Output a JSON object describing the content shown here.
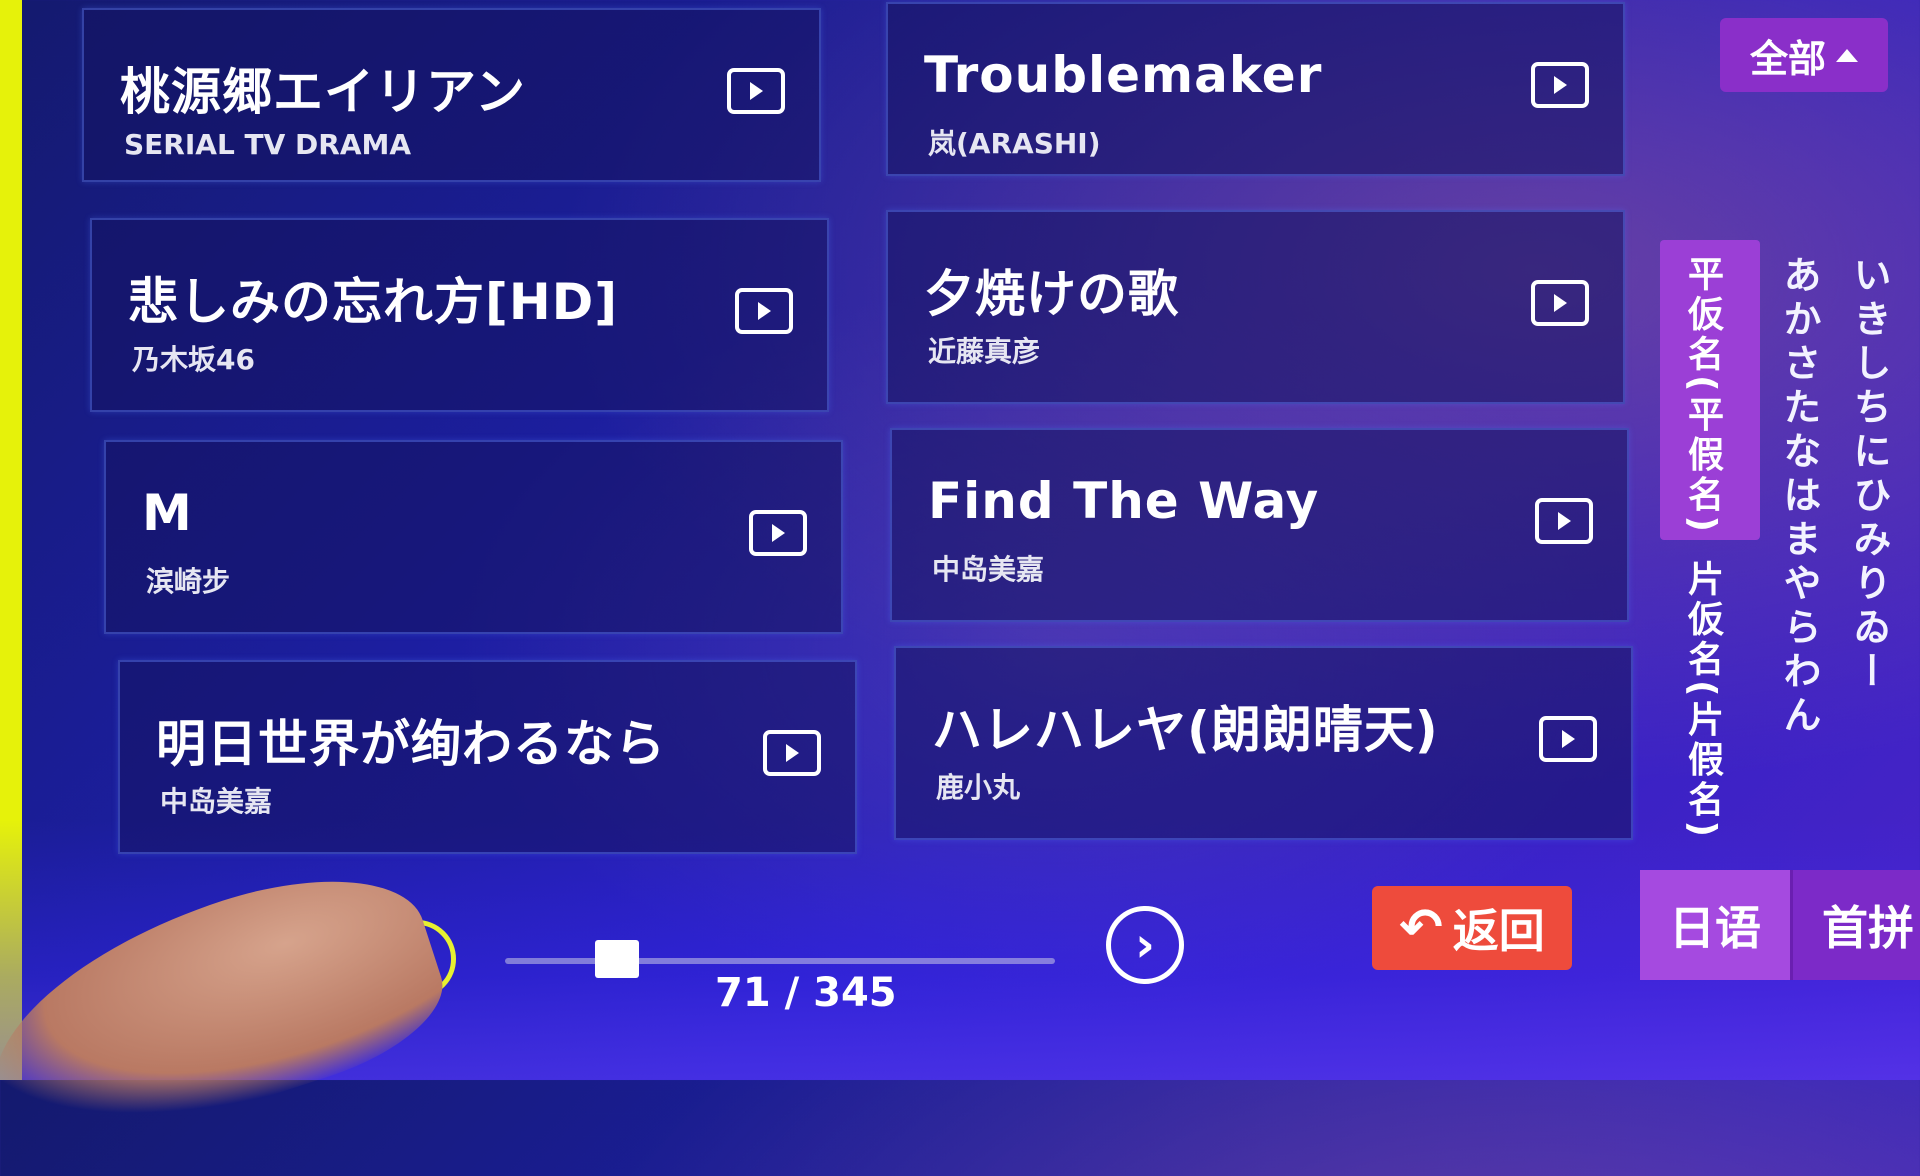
{
  "songs": [
    {
      "title": "桃源郷エイリアン",
      "artist": "SERIAL TV DRAMA"
    },
    {
      "title": "Troublemaker",
      "artist": "岚(ARASHI)"
    },
    {
      "title": "悲しみの忘れ方[HD]",
      "artist": "乃木坂46"
    },
    {
      "title": "夕焼けの歌",
      "artist": "近藤真彦"
    },
    {
      "title": "M",
      "artist": "滨崎步"
    },
    {
      "title": "Find The Way",
      "artist": "中岛美嘉"
    },
    {
      "title": "明日世界が绚わるなら",
      "artist": "中岛美嘉"
    },
    {
      "title": "ハレハレヤ(朗朗晴天)",
      "artist": "鹿小丸"
    }
  ],
  "filter": {
    "all_label": "全部"
  },
  "index": {
    "hiragana_label": "平仮名(平假名)",
    "katakana_label": "片仮名(片假名)",
    "kana_columns": [
      "あかさたなはまやらわん",
      "いきしちにひみりゐー"
    ]
  },
  "lang_tabs": [
    "日语",
    "首拼"
  ],
  "back_label": "返回",
  "pagination": {
    "current": 71,
    "total": 345,
    "text": "71 / 345"
  }
}
